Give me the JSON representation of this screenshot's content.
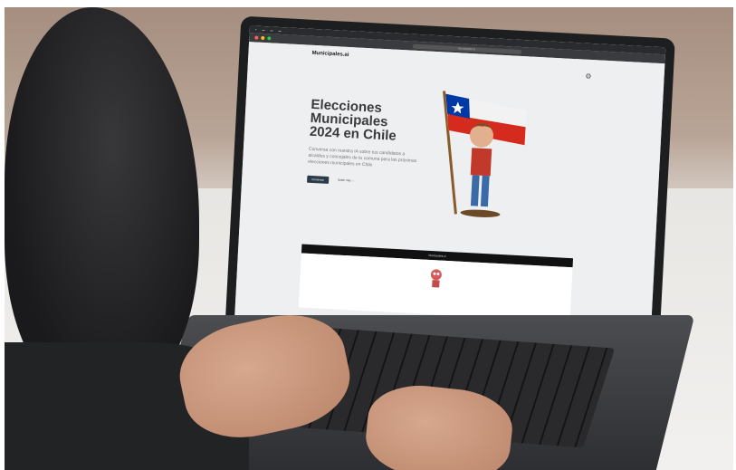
{
  "site": {
    "logo": "Municipales.ai",
    "headline": "Elecciones Municipales 2024 en Chile",
    "subtext": "Conversa con nuestra IA sobre tus candidatos a alcaldes y concejales de tu comuna para las próximas elecciones municipales en Chile",
    "primary_button": "Comenzar",
    "secondary_link": "Saber más →",
    "chat_title": "Municipales.ai"
  },
  "browser": {
    "url": "municipales.ai"
  },
  "colors": {
    "flag_red": "#d52b1e",
    "flag_blue": "#0039a6",
    "button_dark": "#2c3a4a"
  }
}
